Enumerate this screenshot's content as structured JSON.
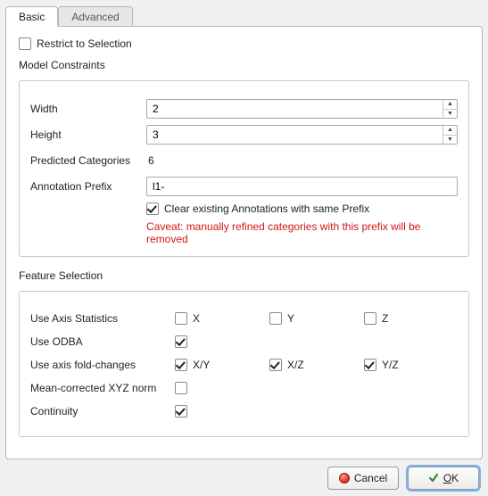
{
  "tabs": {
    "basic": "Basic",
    "advanced": "Advanced"
  },
  "restrict_label": "Restrict to Selection",
  "restrict_checked": false,
  "model_legend": "Model Constraints",
  "model": {
    "width_label": "Width",
    "width_value": "2",
    "height_label": "Height",
    "height_value": "3",
    "predicted_label": "Predicted Categories",
    "predicted_value": "6",
    "prefix_label": "Annotation Prefix",
    "prefix_value": "l1-",
    "clear_label": "Clear existing Annotations with same Prefix",
    "clear_checked": true,
    "caveat": "Caveat: manually refined categories with this prefix will be removed"
  },
  "feature_legend": "Feature Selection",
  "feature": {
    "axis_stats_label": "Use Axis Statistics",
    "axis_x_label": "X",
    "axis_x_checked": false,
    "axis_y_label": "Y",
    "axis_y_checked": false,
    "axis_z_label": "Z",
    "axis_z_checked": false,
    "odba_label": "Use ODBA",
    "odba_checked": true,
    "fold_label": "Use axis fold-changes",
    "fold_xy_label": "X/Y",
    "fold_xy_checked": true,
    "fold_xz_label": "X/Z",
    "fold_xz_checked": true,
    "fold_yz_label": "Y/Z",
    "fold_yz_checked": true,
    "meancorr_label": "Mean-corrected XYZ norm",
    "meancorr_checked": false,
    "continuity_label": "Continuity",
    "continuity_checked": true
  },
  "buttons": {
    "cancel": "Cancel",
    "ok": "OK",
    "ok_mnemonic": "O",
    "ok_rest": "K"
  }
}
